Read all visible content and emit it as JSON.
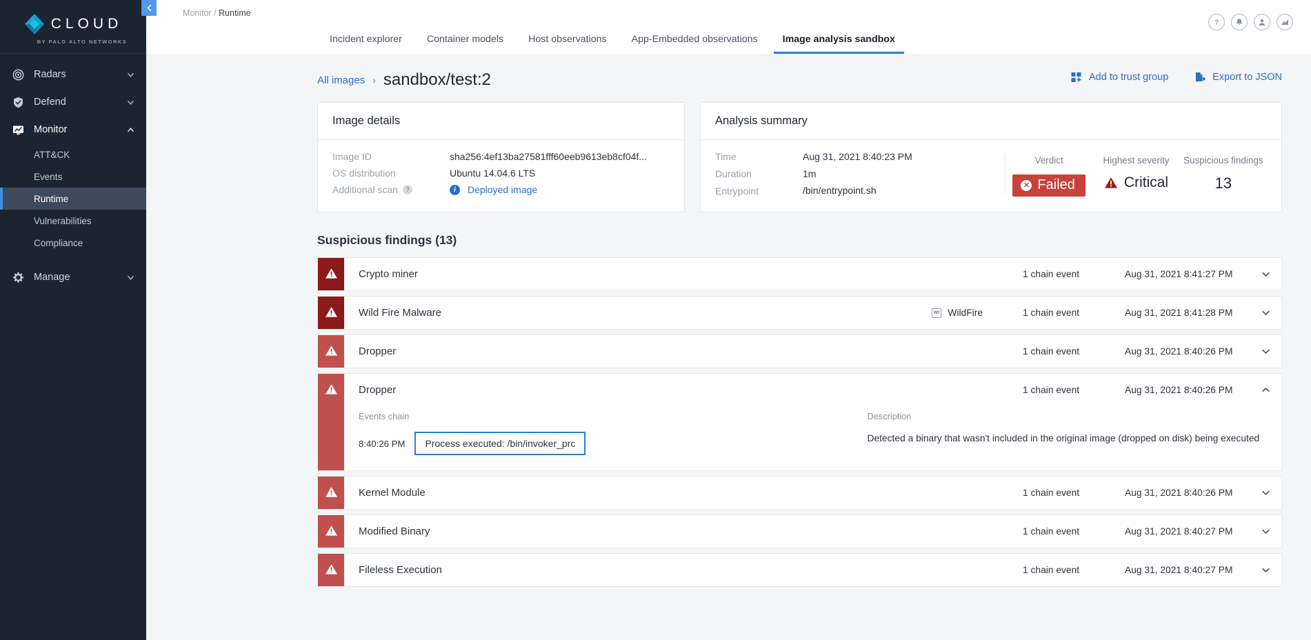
{
  "sidebar": {
    "brand": {
      "name": "CLOUD",
      "sub": "BY PALO ALTO NETWORKS"
    },
    "groups": [
      {
        "label": "Radars",
        "icon": "radar-icon",
        "expanded": false
      },
      {
        "label": "Defend",
        "icon": "shield-icon",
        "expanded": false
      },
      {
        "label": "Monitor",
        "icon": "monitor-icon",
        "expanded": true
      },
      {
        "label": "Manage",
        "icon": "gear-icon",
        "expanded": false
      }
    ],
    "monitor_items": [
      {
        "label": "ATT&CK",
        "selected": false
      },
      {
        "label": "Events",
        "selected": false
      },
      {
        "label": "Runtime",
        "selected": true
      },
      {
        "label": "Vulnerabilities",
        "selected": false
      },
      {
        "label": "Compliance",
        "selected": false
      }
    ]
  },
  "topbar": {
    "breadcrumb_parent": "Monitor",
    "breadcrumb_sep": "/",
    "breadcrumb_current": "Runtime",
    "icons": [
      "help-icon",
      "bell-icon",
      "user-icon",
      "chart-icon"
    ],
    "tabs": [
      {
        "label": "Incident explorer",
        "active": false
      },
      {
        "label": "Container models",
        "active": false
      },
      {
        "label": "Host observations",
        "active": false
      },
      {
        "label": "App-Embedded observations",
        "active": false
      },
      {
        "label": "Image analysis sandbox",
        "active": true
      }
    ]
  },
  "pagehead": {
    "crumb_all_images": "All images",
    "crumb_sep": "›",
    "title": "sandbox/test:2",
    "add_trust_group": "Add to trust group",
    "export_json": "Export to JSON"
  },
  "image_details": {
    "title": "Image details",
    "rows": [
      {
        "key": "Image ID",
        "value": "sha256:4ef13ba27581fff60eeb9613eb8cf04f...",
        "help": false,
        "link": false
      },
      {
        "key": "OS distribution",
        "value": "Ubuntu 14.04.6 LTS",
        "help": false,
        "link": false
      },
      {
        "key": "Additional scan",
        "value": "Deployed image",
        "help": true,
        "link": true
      }
    ]
  },
  "analysis_summary": {
    "title": "Analysis summary",
    "rows": [
      {
        "key": "Time",
        "value": "Aug 31, 2021 8:40:23 PM"
      },
      {
        "key": "Duration",
        "value": "1m"
      },
      {
        "key": "Entrypoint",
        "value": "/bin/entrypoint.sh"
      }
    ],
    "verdict_label": "Verdict",
    "verdict_value": "Failed",
    "severity_label": "Highest severity",
    "severity_value": "Critical",
    "findings_label": "Suspicious findings",
    "findings_value": "13"
  },
  "findings": {
    "heading": "Suspicious findings (13)",
    "chain_event_text": "1 chain event",
    "rows": [
      {
        "name": "Crypto miner",
        "tone": "dark",
        "wildfire": false,
        "wildfire_label": "",
        "chain": "1 chain event",
        "time": "Aug 31, 2021 8:41:27 PM",
        "expanded": false
      },
      {
        "name": "Wild Fire Malware",
        "tone": "dark",
        "wildfire": true,
        "wildfire_label": "WildFire",
        "chain": "1 chain event",
        "time": "Aug 31, 2021 8:41:28 PM",
        "expanded": false
      },
      {
        "name": "Dropper",
        "tone": "light",
        "wildfire": false,
        "wildfire_label": "",
        "chain": "1 chain event",
        "time": "Aug 31, 2021 8:40:26 PM",
        "expanded": false
      },
      {
        "name": "Dropper",
        "tone": "light",
        "wildfire": false,
        "wildfire_label": "",
        "chain": "1 chain event",
        "time": "Aug 31, 2021 8:40:26 PM",
        "expanded": true,
        "detail": {
          "events_chain_label": "Events chain",
          "event_time": "8:40:26 PM",
          "event_text": "Process executed: /bin/invoker_prc",
          "description_label": "Description",
          "description": "Detected a binary that wasn't included in the original image (dropped on disk) being executed"
        }
      },
      {
        "name": "Kernel Module",
        "tone": "light",
        "wildfire": false,
        "wildfire_label": "",
        "chain": "1 chain event",
        "time": "Aug 31, 2021 8:40:26 PM",
        "expanded": false
      },
      {
        "name": "Modified Binary",
        "tone": "light",
        "wildfire": false,
        "wildfire_label": "",
        "chain": "1 chain event",
        "time": "Aug 31, 2021 8:40:27 PM",
        "expanded": false
      },
      {
        "name": "Fileless Execution",
        "tone": "light",
        "wildfire": false,
        "wildfire_label": "",
        "chain": "1 chain event",
        "time": "Aug 31, 2021 8:40:27 PM",
        "expanded": false
      }
    ]
  },
  "colors": {
    "accent_blue": "#2d7dd2",
    "link_blue": "#2a6fc9",
    "sidebar_bg": "#1b2431",
    "severity_critical": "#8b1a1a",
    "verdict_failed": "#c9413b",
    "stripe_dark": "#8b1a1a",
    "stripe_light": "#c0504d"
  }
}
